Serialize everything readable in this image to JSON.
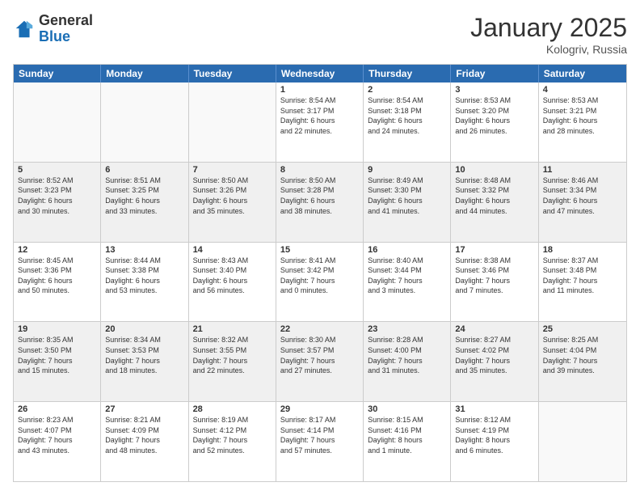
{
  "header": {
    "logo_general": "General",
    "logo_blue": "Blue",
    "month_title": "January 2025",
    "location": "Kologriv, Russia"
  },
  "day_headers": [
    "Sunday",
    "Monday",
    "Tuesday",
    "Wednesday",
    "Thursday",
    "Friday",
    "Saturday"
  ],
  "weeks": [
    {
      "shaded": false,
      "days": [
        {
          "num": "",
          "info": "",
          "empty": true
        },
        {
          "num": "",
          "info": "",
          "empty": true
        },
        {
          "num": "",
          "info": "",
          "empty": true
        },
        {
          "num": "1",
          "info": "Sunrise: 8:54 AM\nSunset: 3:17 PM\nDaylight: 6 hours\nand 22 minutes.",
          "empty": false
        },
        {
          "num": "2",
          "info": "Sunrise: 8:54 AM\nSunset: 3:18 PM\nDaylight: 6 hours\nand 24 minutes.",
          "empty": false
        },
        {
          "num": "3",
          "info": "Sunrise: 8:53 AM\nSunset: 3:20 PM\nDaylight: 6 hours\nand 26 minutes.",
          "empty": false
        },
        {
          "num": "4",
          "info": "Sunrise: 8:53 AM\nSunset: 3:21 PM\nDaylight: 6 hours\nand 28 minutes.",
          "empty": false
        }
      ]
    },
    {
      "shaded": true,
      "days": [
        {
          "num": "5",
          "info": "Sunrise: 8:52 AM\nSunset: 3:23 PM\nDaylight: 6 hours\nand 30 minutes.",
          "empty": false
        },
        {
          "num": "6",
          "info": "Sunrise: 8:51 AM\nSunset: 3:25 PM\nDaylight: 6 hours\nand 33 minutes.",
          "empty": false
        },
        {
          "num": "7",
          "info": "Sunrise: 8:50 AM\nSunset: 3:26 PM\nDaylight: 6 hours\nand 35 minutes.",
          "empty": false
        },
        {
          "num": "8",
          "info": "Sunrise: 8:50 AM\nSunset: 3:28 PM\nDaylight: 6 hours\nand 38 minutes.",
          "empty": false
        },
        {
          "num": "9",
          "info": "Sunrise: 8:49 AM\nSunset: 3:30 PM\nDaylight: 6 hours\nand 41 minutes.",
          "empty": false
        },
        {
          "num": "10",
          "info": "Sunrise: 8:48 AM\nSunset: 3:32 PM\nDaylight: 6 hours\nand 44 minutes.",
          "empty": false
        },
        {
          "num": "11",
          "info": "Sunrise: 8:46 AM\nSunset: 3:34 PM\nDaylight: 6 hours\nand 47 minutes.",
          "empty": false
        }
      ]
    },
    {
      "shaded": false,
      "days": [
        {
          "num": "12",
          "info": "Sunrise: 8:45 AM\nSunset: 3:36 PM\nDaylight: 6 hours\nand 50 minutes.",
          "empty": false
        },
        {
          "num": "13",
          "info": "Sunrise: 8:44 AM\nSunset: 3:38 PM\nDaylight: 6 hours\nand 53 minutes.",
          "empty": false
        },
        {
          "num": "14",
          "info": "Sunrise: 8:43 AM\nSunset: 3:40 PM\nDaylight: 6 hours\nand 56 minutes.",
          "empty": false
        },
        {
          "num": "15",
          "info": "Sunrise: 8:41 AM\nSunset: 3:42 PM\nDaylight: 7 hours\nand 0 minutes.",
          "empty": false
        },
        {
          "num": "16",
          "info": "Sunrise: 8:40 AM\nSunset: 3:44 PM\nDaylight: 7 hours\nand 3 minutes.",
          "empty": false
        },
        {
          "num": "17",
          "info": "Sunrise: 8:38 AM\nSunset: 3:46 PM\nDaylight: 7 hours\nand 7 minutes.",
          "empty": false
        },
        {
          "num": "18",
          "info": "Sunrise: 8:37 AM\nSunset: 3:48 PM\nDaylight: 7 hours\nand 11 minutes.",
          "empty": false
        }
      ]
    },
    {
      "shaded": true,
      "days": [
        {
          "num": "19",
          "info": "Sunrise: 8:35 AM\nSunset: 3:50 PM\nDaylight: 7 hours\nand 15 minutes.",
          "empty": false
        },
        {
          "num": "20",
          "info": "Sunrise: 8:34 AM\nSunset: 3:53 PM\nDaylight: 7 hours\nand 18 minutes.",
          "empty": false
        },
        {
          "num": "21",
          "info": "Sunrise: 8:32 AM\nSunset: 3:55 PM\nDaylight: 7 hours\nand 22 minutes.",
          "empty": false
        },
        {
          "num": "22",
          "info": "Sunrise: 8:30 AM\nSunset: 3:57 PM\nDaylight: 7 hours\nand 27 minutes.",
          "empty": false
        },
        {
          "num": "23",
          "info": "Sunrise: 8:28 AM\nSunset: 4:00 PM\nDaylight: 7 hours\nand 31 minutes.",
          "empty": false
        },
        {
          "num": "24",
          "info": "Sunrise: 8:27 AM\nSunset: 4:02 PM\nDaylight: 7 hours\nand 35 minutes.",
          "empty": false
        },
        {
          "num": "25",
          "info": "Sunrise: 8:25 AM\nSunset: 4:04 PM\nDaylight: 7 hours\nand 39 minutes.",
          "empty": false
        }
      ]
    },
    {
      "shaded": false,
      "days": [
        {
          "num": "26",
          "info": "Sunrise: 8:23 AM\nSunset: 4:07 PM\nDaylight: 7 hours\nand 43 minutes.",
          "empty": false
        },
        {
          "num": "27",
          "info": "Sunrise: 8:21 AM\nSunset: 4:09 PM\nDaylight: 7 hours\nand 48 minutes.",
          "empty": false
        },
        {
          "num": "28",
          "info": "Sunrise: 8:19 AM\nSunset: 4:12 PM\nDaylight: 7 hours\nand 52 minutes.",
          "empty": false
        },
        {
          "num": "29",
          "info": "Sunrise: 8:17 AM\nSunset: 4:14 PM\nDaylight: 7 hours\nand 57 minutes.",
          "empty": false
        },
        {
          "num": "30",
          "info": "Sunrise: 8:15 AM\nSunset: 4:16 PM\nDaylight: 8 hours\nand 1 minute.",
          "empty": false
        },
        {
          "num": "31",
          "info": "Sunrise: 8:12 AM\nSunset: 4:19 PM\nDaylight: 8 hours\nand 6 minutes.",
          "empty": false
        },
        {
          "num": "",
          "info": "",
          "empty": true
        }
      ]
    }
  ]
}
